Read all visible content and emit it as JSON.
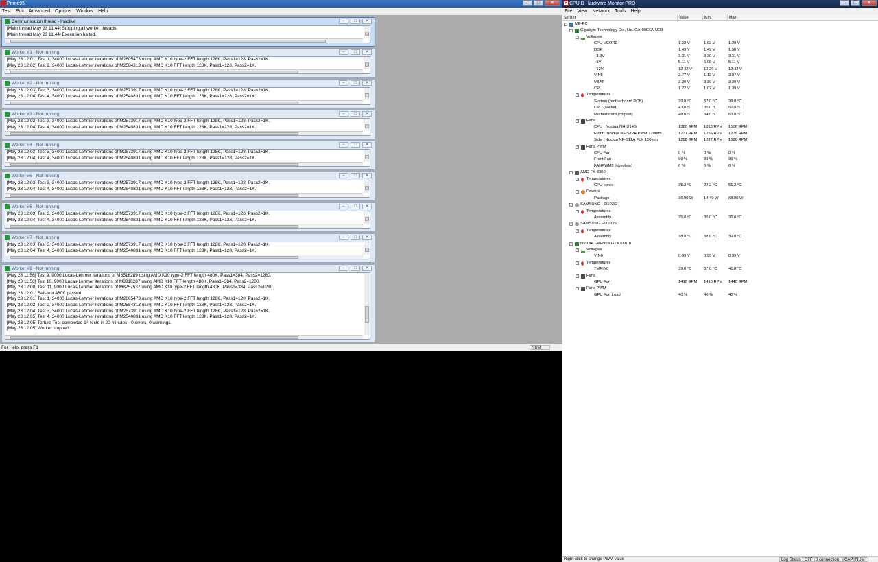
{
  "prime": {
    "title": "Prime95",
    "menu": [
      "Test",
      "Edit",
      "Advanced",
      "Options",
      "Window",
      "Help"
    ],
    "status_left": "For Help, press F1",
    "status_num": "NUM",
    "windows": [
      {
        "title": "Communication thread - Inactive",
        "lines": [
          "[Main thread May 23 11:44] Stopping all worker threads.",
          "[Main thread May 23 11:44] Execution halted."
        ]
      },
      {
        "title": "Worker #1 - Not running",
        "lines": [
          "[May 23 12:01] Test 1, 34000 Lucas-Lehmer iterations of M2605473 using AMD K10 type-2 FFT length 128K, Pass1=128, Pass2=1K.",
          "[May 23 12:02] Test 2, 34000 Lucas-Lehmer iterations of M2584313 using AMD K10 FFT length 128K, Pass1=128, Pass2=1K."
        ]
      },
      {
        "title": "Worker #2 - Not running",
        "lines": [
          "[May 23 12:03] Test 3, 34000 Lucas-Lehmer iterations of M2573917 using AMD K10 type-2 FFT length 128K, Pass1=128, Pass2=1K.",
          "[May 23 12:04] Test 4, 34000 Lucas-Lehmer iterations of M2540831 using AMD K10 FFT length 128K, Pass1=128, Pass2=1K."
        ]
      },
      {
        "title": "Worker #3 - Not running",
        "lines": [
          "[May 23 12:03] Test 3, 34000 Lucas-Lehmer iterations of M2573917 using AMD K10 type-2 FFT length 128K, Pass1=128, Pass2=1K.",
          "[May 23 12:04] Test 4, 34000 Lucas-Lehmer iterations of M2540831 using AMD K10 FFT length 128K, Pass1=128, Pass2=1K."
        ]
      },
      {
        "title": "Worker #4 - Not running",
        "lines": [
          "[May 23 12:03] Test 3, 34000 Lucas-Lehmer iterations of M2573917 using AMD K10 type-2 FFT length 128K, Pass1=128, Pass2=1K.",
          "[May 23 12:04] Test 4, 34000 Lucas-Lehmer iterations of M2540831 using AMD K10 FFT length 128K, Pass1=128, Pass2=1K."
        ]
      },
      {
        "title": "Worker #5 - Not running",
        "lines": [
          "[May 23 12:03] Test 3, 34000 Lucas-Lehmer iterations of M2573917 using AMD K10 type-2 FFT length 128K, Pass1=128, Pass2=1K.",
          "[May 23 12:04] Test 4, 34000 Lucas-Lehmer iterations of M2540831 using AMD K10 FFT length 128K, Pass1=128, Pass2=1K."
        ]
      },
      {
        "title": "Worker #6 - Not running",
        "lines": [
          "[May 23 12:03] Test 3, 34000 Lucas-Lehmer iterations of M2573917 using AMD K10 type-2 FFT length 128K, Pass1=128, Pass2=1K.",
          "[May 23 12:04] Test 4, 34000 Lucas-Lehmer iterations of M2540831 using AMD K10 FFT length 128K, Pass1=128, Pass2=1K."
        ]
      },
      {
        "title": "Worker #7 - Not running",
        "lines": [
          "[May 23 12:03] Test 3, 34000 Lucas-Lehmer iterations of M2573917 using AMD K10 type-2 FFT length 128K, Pass1=128, Pass2=1K.",
          "[May 23 12:04] Test 4, 34000 Lucas-Lehmer iterations of M2540831 using AMD K10 FFT length 128K, Pass1=128, Pass2=1K."
        ]
      },
      {
        "title": "Worker #8 - Not running",
        "lines": [
          "[May 23 11:56] Test 9, 9000 Lucas-Lehmer iterations of M8516289 using AMD K10 type-2 FFT length 480K, Pass1=384, Pass2=1280.",
          "[May 23 11:58] Test 10, 9000 Lucas-Lehmer iterations of M8316287 using AMD K10 FFT length 480K, Pass1=384, Pass2=1280.",
          "[May 23 12:00] Test 11, 9000 Lucas-Lehmer iterations of M8257537 using AMD K10 type-2 FFT length 480K, Pass1=384, Pass2=1280.",
          "[May 23 12:01] Self-test 480K passed!",
          "[May 23 12:01] Test 1, 34000 Lucas-Lehmer iterations of M2605473 using AMD K10 type-2 FFT length 128K, Pass1=128, Pass2=1K.",
          "[May 23 12:02] Test 2, 34000 Lucas-Lehmer iterations of M2584313 using AMD K10 FFT length 128K, Pass1=128, Pass2=1K.",
          "[May 23 12:04] Test 3, 34000 Lucas-Lehmer iterations of M2573917 using AMD K10 type-2 FFT length 128K, Pass1=128, Pass2=1K.",
          "[May 23 12:05] Test 4, 34000 Lucas-Lehmer iterations of M2540831 using AMD K10 FFT length 128K, Pass1=128, Pass2=1K.",
          "[May 23 12:05] Torture Test completed 14 tests in 20 minutes - 0 errors, 0 warnings.",
          "[May 23 12:05] Worker stopped."
        ]
      }
    ]
  },
  "hwm": {
    "title": "CPUID Hardware Monitor PRO",
    "menu": [
      "File",
      "View",
      "Network",
      "Tools",
      "Help"
    ],
    "columns": [
      "Sensor",
      "Value",
      "Min",
      "Max"
    ],
    "status_left": "Right-click to change PWM value",
    "status_log": "Log Status : OFF",
    "status_conn": "0 connection",
    "status_cap": "CAP",
    "status_num": "NUM",
    "rows": [
      {
        "level": 0,
        "icon": "ic-pc",
        "exp": "-",
        "name": "ME-PC",
        "v": "",
        "mn": "",
        "mx": ""
      },
      {
        "level": 1,
        "icon": "ic-mb",
        "exp": "-",
        "name": "Gigabyte Technology Co., Ltd. GA-990XA-UD3",
        "v": "",
        "mn": "",
        "mx": ""
      },
      {
        "level": 2,
        "icon": "ic-volt",
        "exp": "-",
        "name": "Voltages",
        "v": "",
        "mn": "",
        "mx": ""
      },
      {
        "level": 3,
        "name": "CPU VCORE",
        "v": "1.22 V",
        "mn": "1.02 V",
        "mx": "1.39 V"
      },
      {
        "level": 3,
        "name": "DDR",
        "v": "1.49 V",
        "mn": "1.49 V",
        "mx": "1.50 V"
      },
      {
        "level": 3,
        "name": "+3.3V",
        "v": "3.31 V",
        "mn": "3.30 V",
        "mx": "3.31 V"
      },
      {
        "level": 3,
        "name": "+5V",
        "v": "5.11 V",
        "mn": "5.08 V",
        "mx": "5.11 V"
      },
      {
        "level": 3,
        "name": "+12V",
        "v": "12.42 V",
        "mn": "12.29 V",
        "mx": "12.42 V"
      },
      {
        "level": 3,
        "name": "VIN5",
        "v": "2.77 V",
        "mn": "1.12 V",
        "mx": "3.07 V"
      },
      {
        "level": 3,
        "name": "VBAT",
        "v": "3.30 V",
        "mn": "3.30 V",
        "mx": "3.30 V"
      },
      {
        "level": 3,
        "name": "CPU",
        "v": "1.22 V",
        "mn": "1.02 V",
        "mx": "1.39 V"
      },
      {
        "level": 2,
        "icon": "ic-temp",
        "exp": "-",
        "name": "Temperatures",
        "v": "",
        "mn": "",
        "mx": ""
      },
      {
        "level": 3,
        "name": "System (motherboard PCB)",
        "v": "39.0 °C",
        "mn": "37.0 °C",
        "mx": "39.0 °C"
      },
      {
        "level": 3,
        "name": "CPU (socket)",
        "v": "43.0 °C",
        "mn": "35.0 °C",
        "mx": "52.0 °C"
      },
      {
        "level": 3,
        "name": "Motherboard (chipset)",
        "v": "48.0 °C",
        "mn": "34.0 °C",
        "mx": "63.0 °C"
      },
      {
        "level": 2,
        "icon": "ic-fan",
        "exp": "-",
        "name": "Fans",
        "v": "",
        "mn": "",
        "mx": ""
      },
      {
        "level": 3,
        "name": "CPU   : Noctua NH-U14S",
        "v": "1380 RPM",
        "mn": "1013 RPM",
        "mx": "1506 RPM"
      },
      {
        "level": 3,
        "name": "Front : Noctua NF-S12A PWM 120mm",
        "v": "1271 RPM",
        "mn": "1256 RPM",
        "mx": "1275 RPM"
      },
      {
        "level": 3,
        "name": "Side  : Noctua NF-S12A FLX 120mm",
        "v": "1298 RPM",
        "mn": "1227 RPM",
        "mx": "1326 RPM"
      },
      {
        "level": 2,
        "icon": "ic-fan",
        "exp": "-",
        "name": "Fans PWM",
        "v": "",
        "mn": "",
        "mx": ""
      },
      {
        "level": 3,
        "name": "CPU Fan",
        "v": "0 %",
        "mn": "0 %",
        "mx": "0 %"
      },
      {
        "level": 3,
        "name": "Front Fan",
        "v": "99 %",
        "mn": "99 %",
        "mx": "99 %"
      },
      {
        "level": 3,
        "name": "FANPWM2 (obsolete)",
        "v": "0 %",
        "mn": "0 %",
        "mx": "0 %"
      },
      {
        "level": 1,
        "icon": "ic-cpu",
        "exp": "-",
        "name": "AMD FX-8350",
        "v": "",
        "mn": "",
        "mx": ""
      },
      {
        "level": 2,
        "icon": "ic-temp",
        "exp": "-",
        "name": "Temperatures",
        "v": "",
        "mn": "",
        "mx": ""
      },
      {
        "level": 3,
        "name": "CPU cores",
        "v": "35.2 °C",
        "mn": "22.2 °C",
        "mx": "51.2 °C"
      },
      {
        "level": 2,
        "icon": "ic-pwr",
        "exp": "-",
        "name": "Powers",
        "v": "",
        "mn": "",
        "mx": ""
      },
      {
        "level": 3,
        "name": "Package",
        "v": "36.90 W",
        "mn": "14.40 W",
        "mx": "63.90 W"
      },
      {
        "level": 1,
        "icon": "ic-hdd",
        "exp": "-",
        "name": "SAMSUNG HD103SI",
        "v": "",
        "mn": "",
        "mx": ""
      },
      {
        "level": 2,
        "icon": "ic-temp",
        "exp": "-",
        "name": "Temperatures",
        "v": "",
        "mn": "",
        "mx": ""
      },
      {
        "level": 3,
        "name": "Assembly",
        "v": "35.0 °C",
        "mn": "35.0 °C",
        "mx": "36.0 °C"
      },
      {
        "level": 1,
        "icon": "ic-hdd",
        "exp": "-",
        "name": "SAMSUNG HD103SI",
        "v": "",
        "mn": "",
        "mx": ""
      },
      {
        "level": 2,
        "icon": "ic-temp",
        "exp": "-",
        "name": "Temperatures",
        "v": "",
        "mn": "",
        "mx": ""
      },
      {
        "level": 3,
        "name": "Assembly",
        "v": "38.0 °C",
        "mn": "38.0 °C",
        "mx": "39.0 °C"
      },
      {
        "level": 1,
        "icon": "ic-gpu",
        "exp": "-",
        "name": "NVIDIA GeForce GTX 660 Ti",
        "v": "",
        "mn": "",
        "mx": ""
      },
      {
        "level": 2,
        "icon": "ic-volt",
        "exp": "-",
        "name": "Voltages",
        "v": "",
        "mn": "",
        "mx": ""
      },
      {
        "level": 3,
        "name": "VIN0",
        "v": "0.99 V",
        "mn": "0.99 V",
        "mx": "0.99 V"
      },
      {
        "level": 2,
        "icon": "ic-temp",
        "exp": "-",
        "name": "Temperatures",
        "v": "",
        "mn": "",
        "mx": ""
      },
      {
        "level": 3,
        "name": "TMPIN0",
        "v": "39.0 °C",
        "mn": "37.0 °C",
        "mx": "41.0 °C"
      },
      {
        "level": 2,
        "icon": "ic-fan",
        "exp": "-",
        "name": "Fans",
        "v": "",
        "mn": "",
        "mx": ""
      },
      {
        "level": 3,
        "name": "GPU Fan",
        "v": "1410 RPM",
        "mn": "1410 RPM",
        "mx": "1440 RPM"
      },
      {
        "level": 2,
        "icon": "ic-fan",
        "exp": "-",
        "name": "Fans PWM",
        "v": "",
        "mn": "",
        "mx": ""
      },
      {
        "level": 3,
        "name": "GPU Fan Load",
        "v": "40 %",
        "mn": "40 %",
        "mx": "40 %"
      }
    ]
  }
}
